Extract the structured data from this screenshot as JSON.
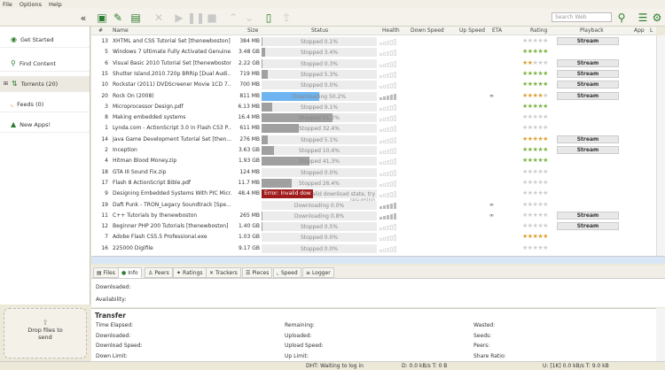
{
  "menu": [
    "File",
    "Options",
    "Help"
  ],
  "toolbar": {
    "search_placeholder": "Search Web"
  },
  "sidebar": {
    "items": [
      {
        "label": "Get Started",
        "icon": "utorrent-logo-icon"
      },
      {
        "label": "Find Content",
        "icon": "search-icon"
      },
      {
        "label": "Torrents (20)",
        "icon": "torrents-icon"
      },
      {
        "label": "Feeds (0)",
        "icon": "rss-icon"
      },
      {
        "label": "New Apps!",
        "icon": "apps-icon"
      }
    ],
    "drop_label": "Drop files to send"
  },
  "columns": [
    "#",
    "Name",
    "Size",
    "Status",
    "Health",
    "Down Speed",
    "Up Speed",
    "ETA",
    "Rating",
    "Playback",
    "App",
    "L"
  ],
  "torrents": [
    {
      "num": "13",
      "name": "XHTML and CSS Tutorial Set [thenewboston]",
      "size": "384 MB",
      "status": "Stopped 0.1%",
      "progress": 0.1,
      "health": 0,
      "eta": "",
      "rating": 0,
      "rating_color": "grey",
      "stream": true
    },
    {
      "num": "5",
      "name": "Windows 7 Ultimate Fully Activated Genuine...",
      "size": "3.48 GB",
      "status": "Stopped 3.4%",
      "progress": 3.4,
      "health": 0,
      "eta": "",
      "rating": 5,
      "rating_color": "green",
      "stream": false
    },
    {
      "num": "6",
      "name": "Visual Basic 2010 Tutorial Set [thenewboston]",
      "size": "2.22 GB",
      "status": "Stopped 0.3%",
      "progress": 0.3,
      "health": 0,
      "eta": "",
      "rating": 2,
      "rating_color": "orange",
      "stream": true
    },
    {
      "num": "15",
      "name": "Shutter Island.2010.720p BRRip [Dual Audi...",
      "size": "719 MB",
      "status": "Stopped 5.3%",
      "progress": 5.3,
      "health": 0,
      "eta": "",
      "rating": 5,
      "rating_color": "green",
      "stream": true
    },
    {
      "num": "10",
      "name": "Rockstar (2011) DVDScreener Movie 1CD 7...",
      "size": "700 MB",
      "status": "Stopped 0.0%",
      "progress": 0,
      "health": 0,
      "eta": "",
      "rating": 5,
      "rating_color": "green",
      "stream": true
    },
    {
      "num": "20",
      "name": "Rock On (2008)",
      "size": "811 MB",
      "status": "Downloading 50.2%",
      "progress": 50.2,
      "health": 1,
      "eta": "∞",
      "rating": 4,
      "rating_color": "orange",
      "stream": true,
      "downloading": true
    },
    {
      "num": "3",
      "name": "Microprocessor Design.pdf",
      "size": "6.13 MB",
      "status": "Stopped 9.1%",
      "progress": 9.1,
      "health": 0,
      "eta": "",
      "rating": 5,
      "rating_color": "green",
      "stream": false
    },
    {
      "num": "8",
      "name": "Making embedded systems",
      "size": "16.4 MB",
      "status": "Stopped 61.2%",
      "progress": 61.2,
      "health": 0,
      "eta": "",
      "rating": 0,
      "rating_color": "grey",
      "stream": false
    },
    {
      "num": "1",
      "name": "Lynda.com - ActionScript 3.0 in Flash CS3 P...",
      "size": "611 MB",
      "status": "Stopped 32.4%",
      "progress": 32.4,
      "health": 0,
      "eta": "",
      "rating": 0,
      "rating_color": "grey",
      "stream": false
    },
    {
      "num": "14",
      "name": "Java Game Development Tutorial Set [then...",
      "size": "276 MB",
      "status": "Stopped 5.1%",
      "progress": 5.1,
      "health": 0,
      "eta": "",
      "rating": 5,
      "rating_color": "orange",
      "stream": true
    },
    {
      "num": "2",
      "name": "Inception",
      "size": "3.63 GB",
      "status": "Stopped 10.4%",
      "progress": 10.4,
      "health": 0,
      "eta": "",
      "rating": 5,
      "rating_color": "green",
      "stream": true
    },
    {
      "num": "4",
      "name": "Hitman Blood Money.zip",
      "size": "1.93 GB",
      "status": "Stopped 41.3%",
      "progress": 41.3,
      "health": 0,
      "eta": "",
      "rating": 5,
      "rating_color": "green",
      "stream": false
    },
    {
      "num": "18",
      "name": "GTA III Sound Fix.zip",
      "size": "124 MB",
      "status": "Stopped 0.0%",
      "progress": 0,
      "health": 0,
      "eta": "",
      "rating": 0,
      "rating_color": "grey",
      "stream": false
    },
    {
      "num": "17",
      "name": "Flash 8 ActionScript Bible.pdf",
      "size": "11.7 MB",
      "status": "Stopped 26.4%",
      "progress": 26.4,
      "health": 0,
      "eta": "",
      "rating": 0,
      "rating_color": "grey",
      "stream": false
    },
    {
      "num": "9",
      "name": "Designing Embedded Systems With PIC Micr...",
      "size": "48.4 MB",
      "status": "Error: Invalid download state, try resuming",
      "progress": 0,
      "health": 0,
      "eta": "",
      "rating": 0,
      "rating_color": "grey",
      "stream": false,
      "error": true
    },
    {
      "num": "19",
      "name": "Daft Punk - TRON_Legacy Soundtrack [Spe...",
      "size": "",
      "status": "Downloading 0.0%",
      "progress": 0,
      "health": 1,
      "eta": "∞",
      "rating": 0,
      "rating_color": "grey",
      "stream": false
    },
    {
      "num": "11",
      "name": "C++ Tutorials by thenewboston",
      "size": "265 MB",
      "status": "Downloading 0.8%",
      "progress": 0.8,
      "health": 1,
      "eta": "∞",
      "rating": 0,
      "rating_color": "grey",
      "stream": true
    },
    {
      "num": "12",
      "name": "Beginner PHP 200 Tutorials [thenewboston]",
      "size": "1.40 GB",
      "status": "Stopped 0.5%",
      "progress": 0.5,
      "health": 0,
      "eta": "",
      "rating": 0,
      "rating_color": "grey",
      "stream": true
    },
    {
      "num": "7",
      "name": "Adobe Flash CS5.5 Professional.exe",
      "size": "1.03 GB",
      "status": "Stopped 0.0%",
      "progress": 0,
      "health": 0,
      "eta": "",
      "rating": 5,
      "rating_color": "orange",
      "stream": false
    },
    {
      "num": "16",
      "name": "225000 Digifile",
      "size": "9.17 GB",
      "status": "Stopped 0.0%",
      "progress": 0,
      "health": 0,
      "eta": "",
      "rating": 0,
      "rating_color": "grey",
      "stream": false
    }
  ],
  "stream_label": "Stream",
  "tabs": [
    "Files",
    "Info",
    "Peers",
    "Ratings",
    "Trackers",
    "Pieces",
    "Speed",
    "Logger"
  ],
  "info": {
    "downloaded": "Downloaded:",
    "availability": "Availability:"
  },
  "transfer": {
    "title": "Transfer",
    "labels": [
      [
        "Time Elapsed:",
        "Remaining:",
        "Wasted:"
      ],
      [
        "Downloaded:",
        "Uploaded:",
        "Seeds:"
      ],
      [
        "Download Speed:",
        "Upload Speed:",
        "Peers:"
      ],
      [
        "Down Limit:",
        "Up Limit:",
        "Share Ratio:"
      ]
    ]
  },
  "status": {
    "dht": "DHT: Waiting to log in",
    "down": "D: 0.0 kB/s T: 0 B",
    "up": "U: [1K] 0.0 kB/s T: 9.0 kB"
  },
  "colors": {
    "accent": "#2f7d32",
    "download": "#6eb4f0",
    "error": "#a01c1c",
    "star_green": "#7cb342",
    "star_orange": "#e0a030"
  }
}
